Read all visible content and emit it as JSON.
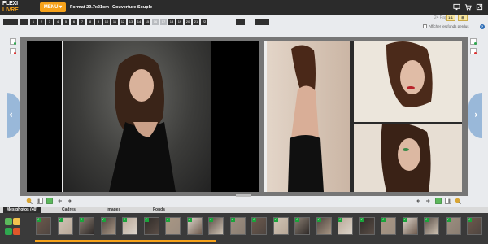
{
  "header": {
    "logo_line1": "FLEXI",
    "logo_line2": "LIVRE",
    "menu_label": "MENU ▾",
    "format_label": "Format 29.7x21cm",
    "cover_label": "Couverture Souple",
    "icons": [
      "monitor-icon",
      "cart-icon",
      "expand-icon"
    ]
  },
  "pages": {
    "items": [
      "1",
      "2",
      "3",
      "4",
      "5",
      "6",
      "7",
      "8",
      "9",
      "10",
      "11",
      "12",
      "13",
      "14",
      "15",
      "16",
      "17",
      "18",
      "19",
      "20",
      "21",
      "22"
    ],
    "current": [
      "16",
      "17"
    ],
    "count_label": "24 Pages",
    "zoom_values": [
      "1:1",
      "⊞"
    ]
  },
  "options": {
    "bleed_label": "Afficher les fonds perdus",
    "help": "?"
  },
  "tabs": [
    {
      "label": "Mes photos (40)"
    },
    {
      "label": "Cadres"
    },
    {
      "label": "Images"
    },
    {
      "label": "Fonds"
    }
  ],
  "tray": {
    "checkmark": "✓",
    "thumb_count": 21
  },
  "colors": {
    "accent": "#f6a21a",
    "topbar": "#2b2b2b",
    "check": "#1aa33b",
    "nav": "#99b8d9"
  }
}
